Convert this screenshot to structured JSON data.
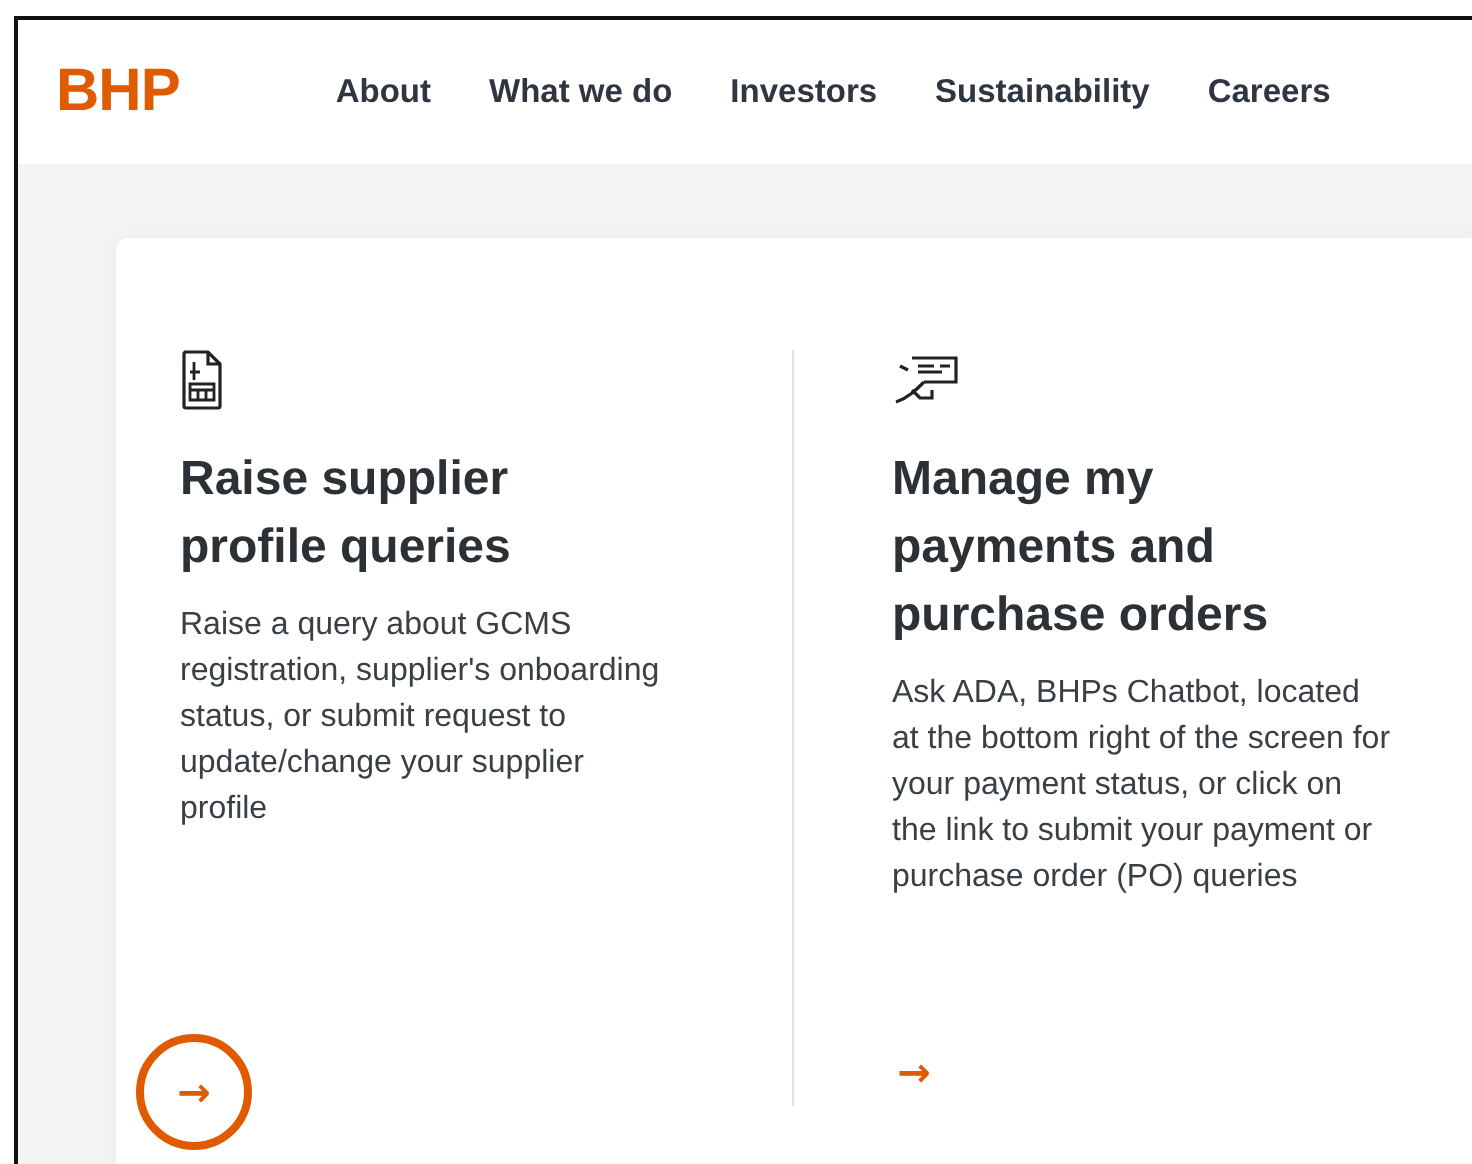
{
  "header": {
    "logo": "BHP",
    "nav": [
      "About",
      "What we do",
      "Investors",
      "Sustainability",
      "Careers"
    ]
  },
  "cards": [
    {
      "kind": "invoice",
      "title": "Raise supplier profile queries",
      "description": "Raise a query about GCMS registration, supplier's onboarding status, or submit request to update/change your supplier profile",
      "link_arrow": "→",
      "highlighted": true
    },
    {
      "kind": "cheque",
      "title": "Manage my payments and purchase orders",
      "description": "Ask ADA, BHPs Chatbot, located at the bottom right of the screen for your payment status, or click on the link to submit your payment or purchase order (PO) queries",
      "link_arrow": "→",
      "highlighted": false
    }
  ]
}
